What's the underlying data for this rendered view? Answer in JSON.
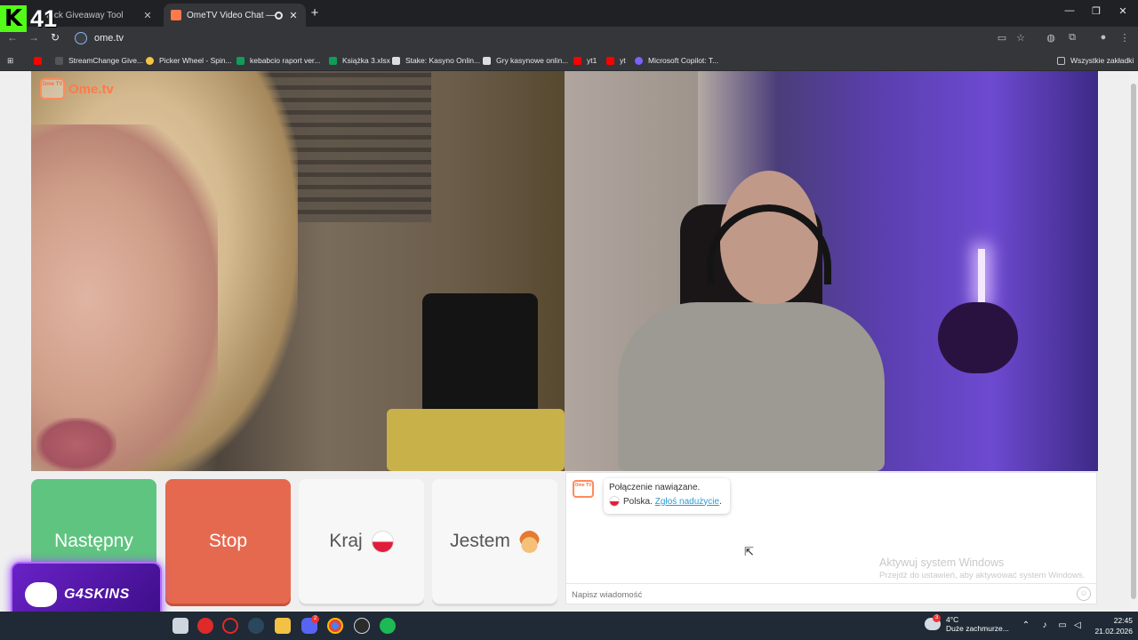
{
  "browser": {
    "tabs": [
      {
        "title": "Kick Giveaway Tool",
        "active": false
      },
      {
        "title": "OmeTV Video Chat — Ome",
        "active": true
      }
    ],
    "new_tab": "+",
    "url": "ome.tv",
    "bookmarks": [
      {
        "label": "",
        "color": "#ff0000"
      },
      {
        "label": "StreamChange Give...",
        "color": "#555555"
      },
      {
        "label": "Picker Wheel - Spin...",
        "color": "#f4c542"
      },
      {
        "label": "kebabcio raport ver...",
        "color": "#0f9d58"
      },
      {
        "label": "Książka 3.xlsx",
        "color": "#0f9d58"
      },
      {
        "label": "Stake: Kasyno Onlin...",
        "color": "#ffffff"
      },
      {
        "label": "Gry kasynowe onlin...",
        "color": "#ffffff"
      },
      {
        "label": "yt1",
        "color": "#ff0000"
      },
      {
        "label": "yt",
        "color": "#ff0000"
      },
      {
        "label": "Microsoft Copilot: T...",
        "color": "#7b61ff"
      }
    ],
    "all_bookmarks": "Wszystkie zakładki"
  },
  "overlay": {
    "kick_logo": "K",
    "kick_number": "41",
    "sponsor": "G4SKINS"
  },
  "ometv": {
    "logo_box": "Ome TV",
    "logo_text": "Ome.tv",
    "buttons": {
      "next": "Następny",
      "stop": "Stop",
      "country": "Kraj",
      "gender": "Jestem"
    },
    "chat": {
      "connected": "Połączenie nawiązane.",
      "country": "Polska.",
      "report": "Zgłoś nadużycie",
      "report_suffix": ".",
      "placeholder": "Napisz wiadomość"
    }
  },
  "windows": {
    "activate_title": "Aktywuj system Windows",
    "activate_sub": "Przejdź do ustawień, aby aktywować system Windows.",
    "weather_temp": "4°C",
    "weather_desc": "Duże zachmurze...",
    "weather_badge": "3",
    "discord_badge": "2",
    "time": "22:45",
    "date": "21.02.2026"
  },
  "colors": {
    "next": "#5fc47f",
    "stop": "#e5694f",
    "ometv_orange": "#ff7a4a",
    "kick_green": "#53fc18",
    "sponsor_purple": "#6a22c7"
  }
}
